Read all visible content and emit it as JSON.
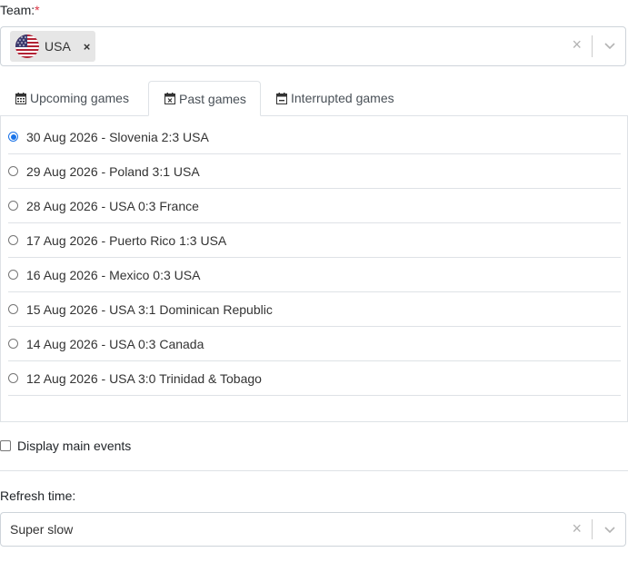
{
  "team": {
    "label": "Team:",
    "required_mark": "*",
    "selected": [
      {
        "flag": "usa-flag-icon",
        "label": "USA",
        "remove": "×"
      }
    ],
    "clear": "×"
  },
  "tabs": [
    {
      "label": "Upcoming games",
      "icon": "calendar-icon",
      "active": false
    },
    {
      "label": "Past games",
      "icon": "calendar-x-icon",
      "active": true
    },
    {
      "label": "Interrupted games",
      "icon": "calendar-minus-icon",
      "active": false
    }
  ],
  "games": [
    {
      "label": "30 Aug 2026 - Slovenia 2:3 USA",
      "selected": true
    },
    {
      "label": "29 Aug 2026 - Poland 3:1 USA",
      "selected": false
    },
    {
      "label": "28 Aug 2026 - USA 0:3 France",
      "selected": false
    },
    {
      "label": "17 Aug 2026 - Puerto Rico 1:3 USA",
      "selected": false
    },
    {
      "label": "16 Aug 2026 - Mexico 0:3 USA",
      "selected": false
    },
    {
      "label": "15 Aug 2026 - USA 3:1 Dominican Republic",
      "selected": false
    },
    {
      "label": "14 Aug 2026 - USA 0:3 Canada",
      "selected": false
    },
    {
      "label": "12 Aug 2026 - USA 3:0 Trinidad & Tobago",
      "selected": false
    }
  ],
  "display_main_events": {
    "label": "Display main events",
    "checked": false
  },
  "refresh": {
    "label": "Refresh time:",
    "value": "Super slow",
    "clear": "×"
  },
  "colors": {
    "accent": "#1a73e8",
    "required": "#dc3545",
    "border": "#dee2e6"
  }
}
